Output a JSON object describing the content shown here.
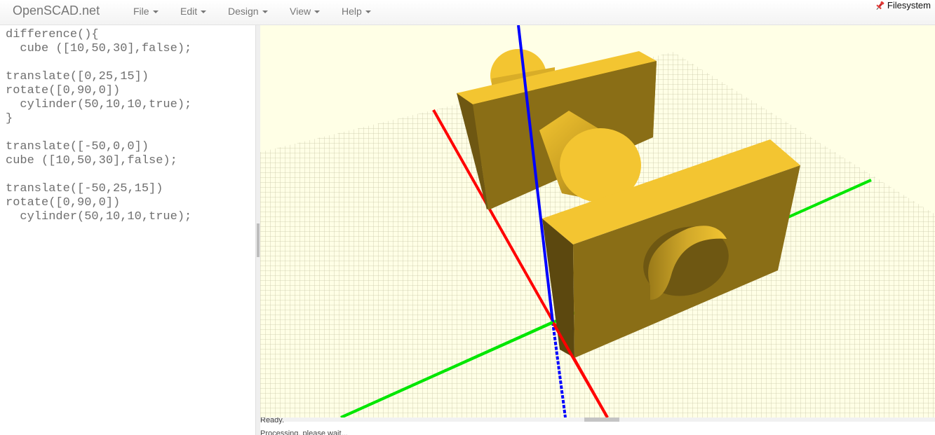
{
  "app": {
    "brand": "OpenSCAD.net"
  },
  "menu": [
    {
      "label": "File"
    },
    {
      "label": "Edit"
    },
    {
      "label": "Design"
    },
    {
      "label": "View"
    },
    {
      "label": "Help"
    }
  ],
  "filesystem": {
    "label": "Filesystem",
    "icon": "pin-icon",
    "icon_color": "#e53935"
  },
  "editor": {
    "lines": [
      "difference(){",
      "  cube ([10,50,30],false);",
      "",
      "translate([0,25,15])",
      "rotate([0,90,0])",
      "  cylinder(50,10,10,true);",
      "}",
      "",
      "translate([-50,0,0])",
      "cube ([10,50,30],false);",
      "",
      "translate([-50,25,15])",
      "rotate([0,90,0])",
      "  cylinder(50,10,10,true);"
    ]
  },
  "viewer": {
    "background": "#ffffe6",
    "grid_color": "#c9c7a8",
    "model_color": "#f3c531",
    "axis_colors": {
      "x": "#ff0000",
      "y": "#00e600",
      "z": "#0000ff"
    }
  },
  "console": {
    "line1": "Ready.",
    "line2": "Processing, please wait..."
  }
}
